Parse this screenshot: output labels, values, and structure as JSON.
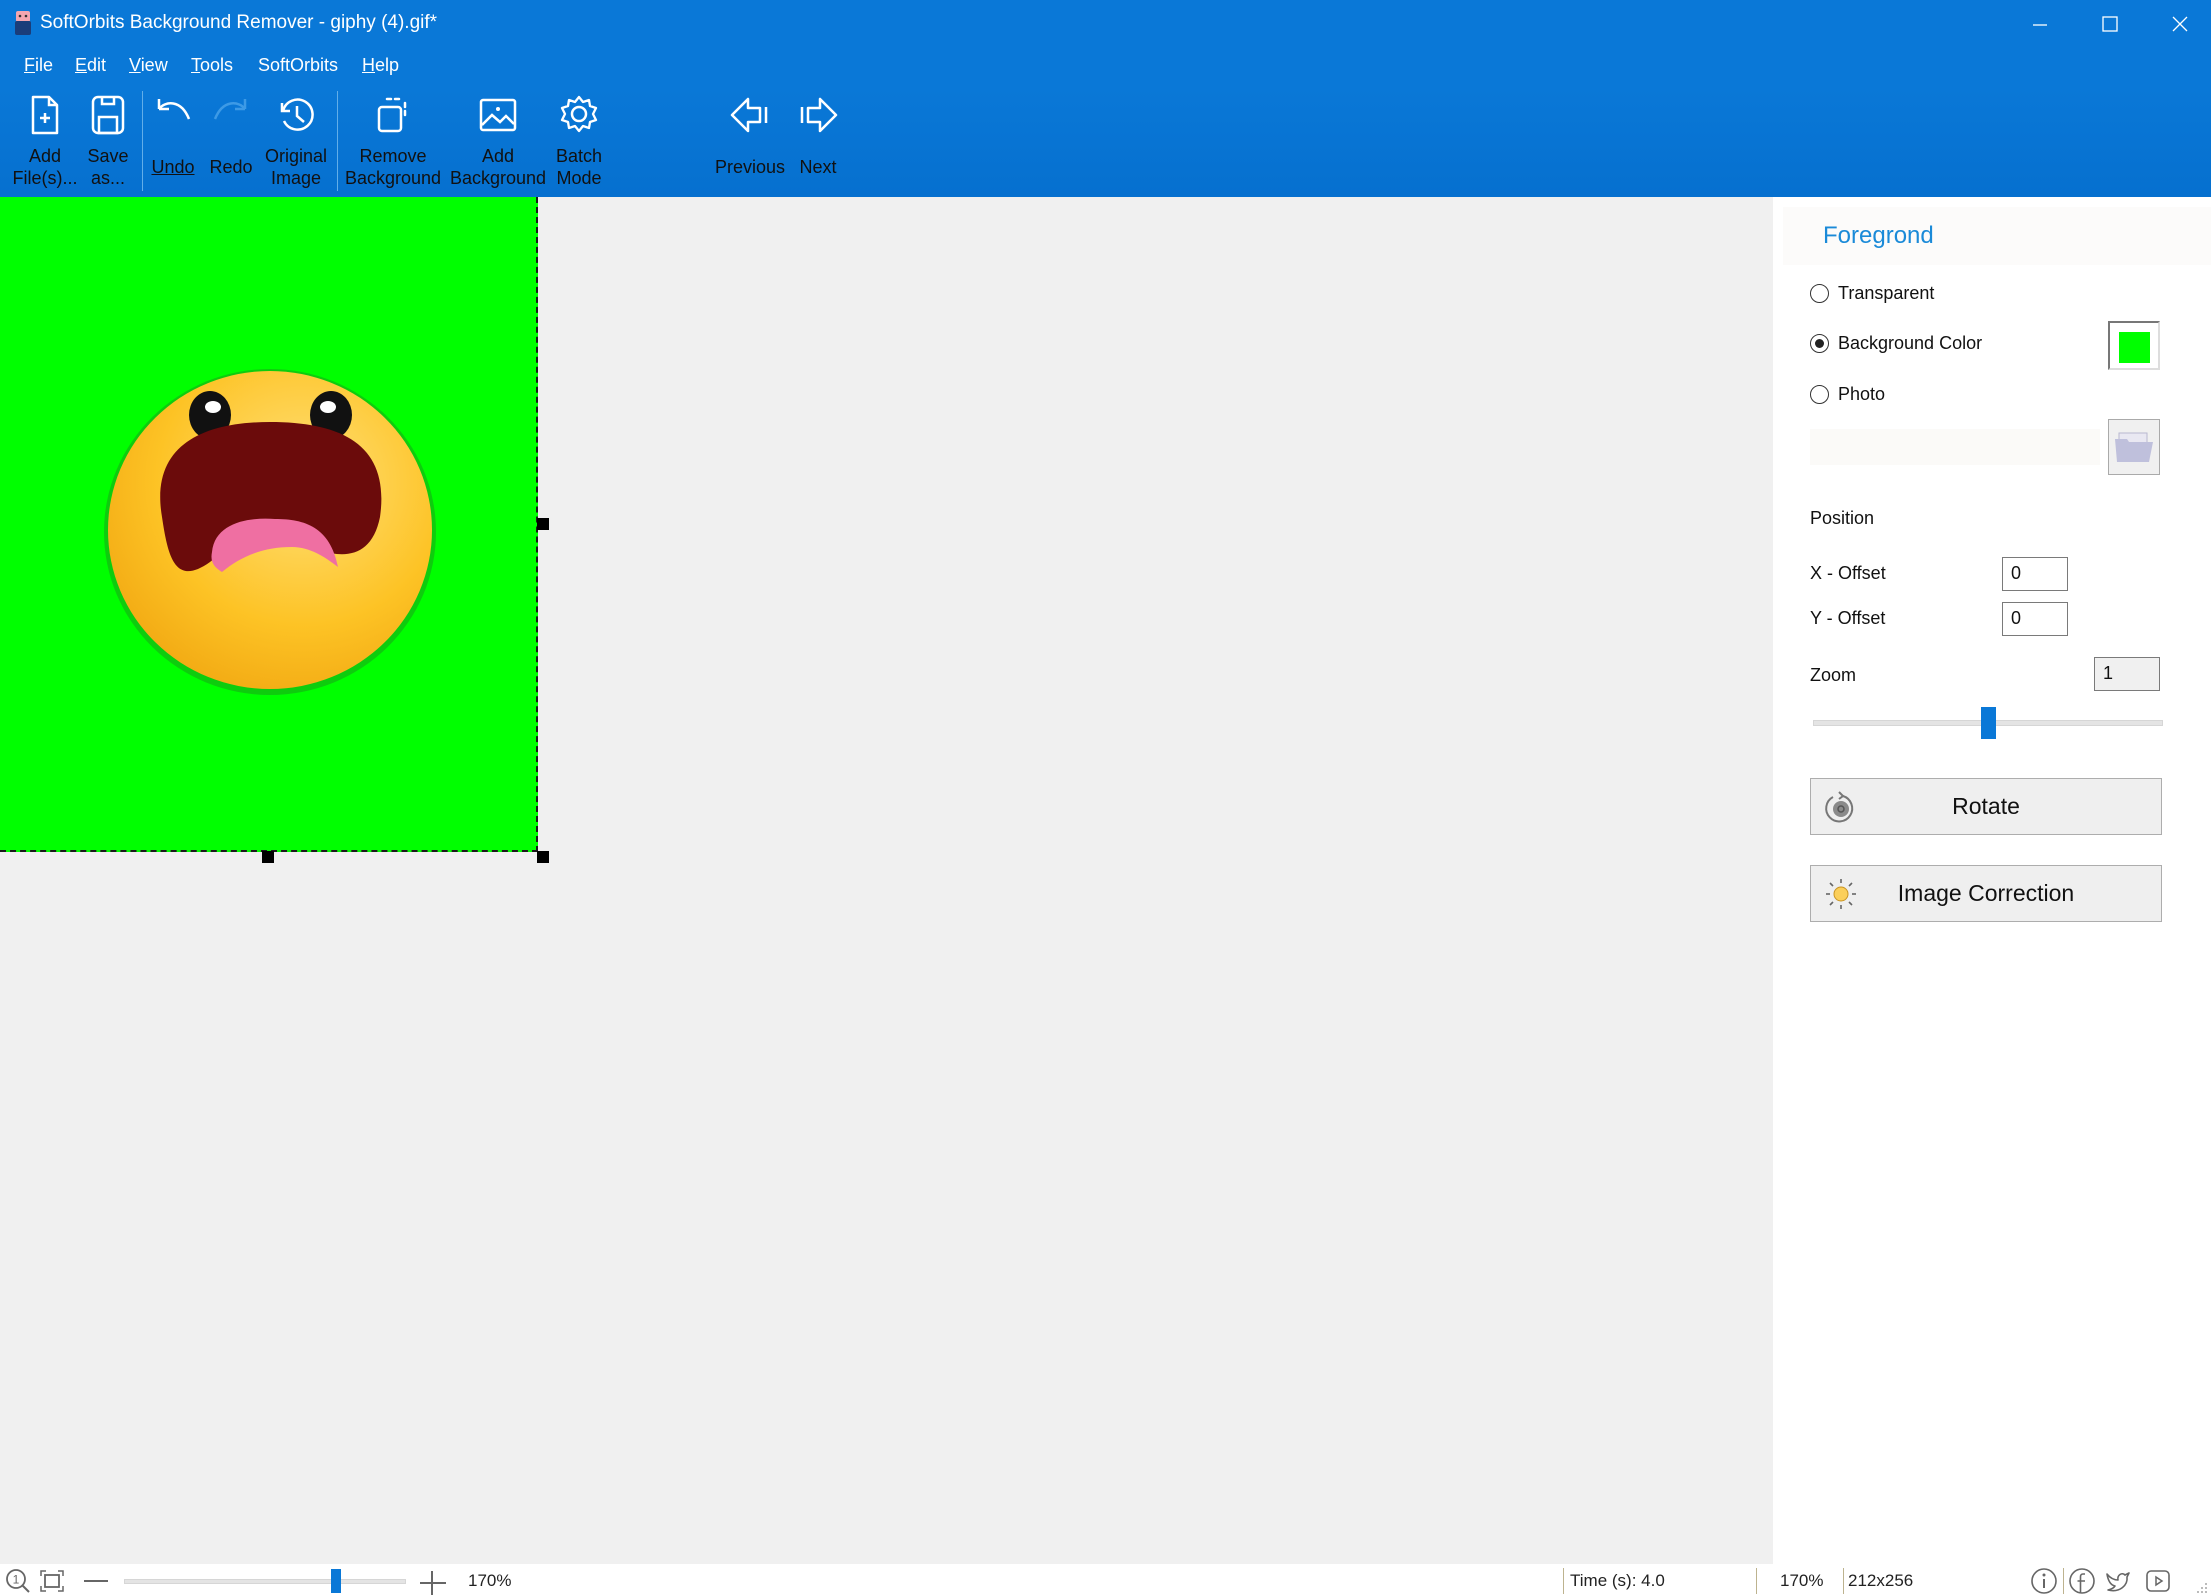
{
  "window": {
    "title": "SoftOrbits Background Remover - giphy (4).gif*",
    "controls": [
      "minimize",
      "maximize",
      "close"
    ]
  },
  "menu": [
    {
      "label": "File",
      "u": "F",
      "rest": "ile"
    },
    {
      "label": "Edit",
      "u": "E",
      "rest": "dit"
    },
    {
      "label": "View",
      "u": "V",
      "rest": "iew"
    },
    {
      "label": "Tools",
      "u": "T",
      "rest": "ools"
    },
    {
      "label": "SoftOrbits",
      "u": "",
      "rest": "SoftOrbits"
    },
    {
      "label": "Help",
      "u": "H",
      "rest": "elp"
    }
  ],
  "toolbar": {
    "add_files": {
      "line1": "Add",
      "line2": "File(s)...",
      "icon": "add-file-icon"
    },
    "save_as": {
      "line1": "Save",
      "line2": "as...",
      "icon": "save-icon"
    },
    "undo": {
      "label": "Undo",
      "icon": "undo-icon"
    },
    "redo": {
      "label": "Redo",
      "icon": "redo-icon",
      "enabled": false
    },
    "original_image": {
      "line1": "Original",
      "line2": "Image",
      "icon": "history-icon"
    },
    "remove_background": {
      "line1": "Remove",
      "line2": "Background",
      "icon": "remove-background-icon"
    },
    "add_background": {
      "line1": "Add",
      "line2": "Background",
      "icon": "image-icon"
    },
    "batch_mode": {
      "line1": "Batch",
      "line2": "Mode",
      "icon": "gear-icon"
    },
    "previous": {
      "label": "Previous",
      "icon": "arrow-left-icon"
    },
    "next": {
      "label": "Next",
      "icon": "arrow-right-icon"
    }
  },
  "canvas": {
    "background_color": "#00ff00",
    "image_subject": "shocked yellow emoji face"
  },
  "panel": {
    "header": "Foregrond",
    "options": [
      {
        "label": "Transparent",
        "selected": false
      },
      {
        "label": "Background Color",
        "selected": true
      },
      {
        "label": "Photo",
        "selected": false
      }
    ],
    "selected_color": "#00ff00",
    "photo_path": "",
    "position_label": "Position",
    "x_offset_label": "X - Offset",
    "x_offset_value": "0",
    "y_offset_label": "Y - Offset",
    "y_offset_value": "0",
    "zoom_label": "Zoom",
    "zoom_value": "1",
    "zoom_slider_fraction": 0.5,
    "rotate_label": "Rotate",
    "image_correction_label": "Image Correction"
  },
  "statusbar": {
    "zoom_percent": "170%",
    "zoom_slider_fraction": 0.75,
    "time": "Time (s): 4.0",
    "zoom_readout": "170%",
    "dimensions": "212x256",
    "icons": [
      "info-icon",
      "facebook-icon",
      "twitter-icon",
      "youtube-icon"
    ]
  },
  "colors": {
    "accent": "#0a78d7",
    "panel_header": "#1a8ad8"
  }
}
